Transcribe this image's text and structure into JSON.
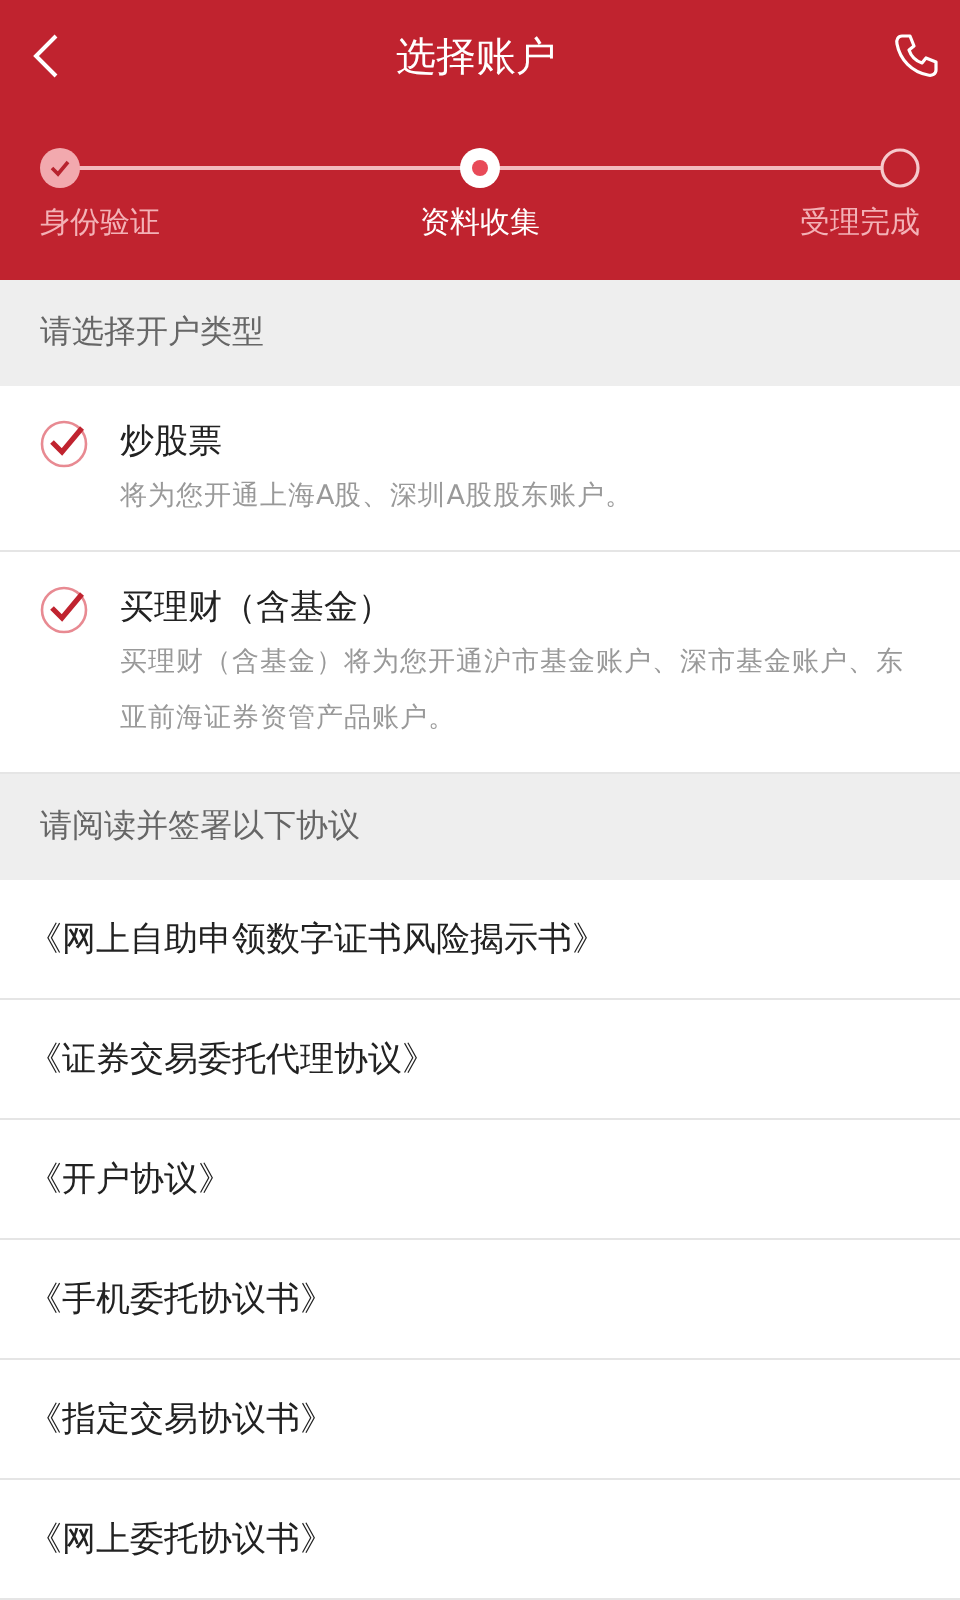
{
  "header": {
    "title": "选择账户"
  },
  "steps": [
    {
      "label": "身份验证",
      "kind": "done"
    },
    {
      "label": "资料收集",
      "kind": "current"
    },
    {
      "label": "受理完成",
      "kind": "pending"
    }
  ],
  "account_section": {
    "heading": "请选择开户类型",
    "options": [
      {
        "title": "炒股票",
        "description": "将为您开通上海A股、深圳A股股东账户。",
        "checked": true
      },
      {
        "title": "买理财（含基金）",
        "description": "买理财（含基金）将为您开通沪市基金账户、深市基金账户、东亚前海证券资管产品账户。",
        "checked": true
      }
    ]
  },
  "agreement_section": {
    "heading": "请阅读并签署以下协议",
    "agreements": [
      "《网上自助申领数字证书风险揭示书》",
      "《证券交易委托代理协议》",
      "《开户协议》",
      "《手机委托协议书》",
      "《指定交易协议书》",
      "《网上委托协议书》"
    ]
  }
}
